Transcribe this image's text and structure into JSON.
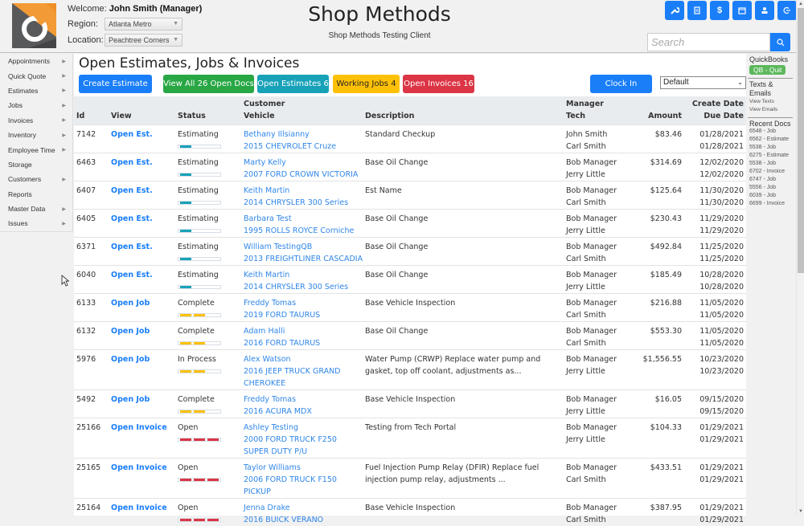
{
  "header": {
    "welcome_label": "Welcome:",
    "user_name": "John Smith (Manager)",
    "region_label": "Region:",
    "region_value": "Atlanta Metro",
    "location_label": "Location:",
    "location_value": "Peachtree Corners",
    "app_title": "Shop Methods",
    "app_subtitle": "Shop Methods Testing Client",
    "search_placeholder": "Search",
    "tool_buttons": [
      "wrench-icon",
      "clipboard-icon",
      "dollar-icon",
      "calendar-icon",
      "user-icon",
      "logout-icon"
    ]
  },
  "sidebar": {
    "items": [
      {
        "label": "Appointments",
        "has_submenu": true
      },
      {
        "label": "Quick Quote",
        "has_submenu": true
      },
      {
        "label": "Estimates",
        "has_submenu": true
      },
      {
        "label": "Jobs",
        "has_submenu": true
      },
      {
        "label": "Invoices",
        "has_submenu": true
      },
      {
        "label": "Inventory",
        "has_submenu": true
      },
      {
        "label": "Employee Time",
        "has_submenu": true
      },
      {
        "label": "Storage",
        "has_submenu": false
      },
      {
        "label": "Customers",
        "has_submenu": true
      },
      {
        "label": "Reports",
        "has_submenu": false
      },
      {
        "label": "Master Data",
        "has_submenu": true
      },
      {
        "label": "Issues",
        "has_submenu": true
      }
    ]
  },
  "main": {
    "title": "Open Estimates, Jobs & Invoices",
    "buttons": {
      "create_estimate": "Create Estimate",
      "view_all": "View All 26 Open Docs",
      "open_estimates": "Open Estimates 6",
      "working_jobs": "Working Jobs 4",
      "open_invoices": "Open Invoices 16",
      "clock_in": "Clock In"
    },
    "view_select": "Default",
    "columns": {
      "id": "Id",
      "view": "View",
      "status": "Status",
      "customer": "Customer",
      "vehicle": "Vehicle",
      "description": "Description",
      "manager": "Manager",
      "tech": "Tech",
      "amount": "Amount",
      "create_date": "Create Date",
      "due_date": "Due Date"
    },
    "rows": [
      {
        "id": "7142",
        "view": "Open Est.",
        "status": "Estimating",
        "progress": "estimate",
        "customer": "Bethany Illsianny",
        "vehicle": "2015 CHEVROLET Cruze",
        "description": "Standard Checkup",
        "manager": "John Smith",
        "tech": "Carl Smith",
        "amount": "$83.46",
        "create_date": "01/28/2021",
        "due_date": "01/28/2021"
      },
      {
        "id": "6463",
        "view": "Open Est.",
        "status": "Estimating",
        "progress": "estimate",
        "customer": "Marty Kelly",
        "vehicle": "2007 FORD CROWN VICTORIA",
        "description": "Base Oil Change",
        "manager": "Bob Manager",
        "tech": "Jerry Little",
        "amount": "$314.69",
        "create_date": "12/02/2020",
        "due_date": "12/02/2020"
      },
      {
        "id": "6407",
        "view": "Open Est.",
        "status": "Estimating",
        "progress": "estimate",
        "customer": "Keith Martin",
        "vehicle": "2014 CHRYSLER 300 Series",
        "description": "Est Name",
        "manager": "Bob Manager",
        "tech": "Carl Smith",
        "amount": "$125.64",
        "create_date": "11/30/2020",
        "due_date": "11/30/2020"
      },
      {
        "id": "6405",
        "view": "Open Est.",
        "status": "Estimating",
        "progress": "estimate",
        "customer": "Barbara Test",
        "vehicle": "1995 ROLLS ROYCE Corniche",
        "description": "Base Oil Change",
        "manager": "Bob Manager",
        "tech": "Jerry Little",
        "amount": "$230.43",
        "create_date": "11/29/2020",
        "due_date": "11/29/2020"
      },
      {
        "id": "6371",
        "view": "Open Est.",
        "status": "Estimating",
        "progress": "estimate",
        "customer": "William TestingQB",
        "vehicle": "2013 FREIGHTLINER CASCADIA",
        "description": "Base Oil Change",
        "manager": "Bob Manager",
        "tech": "Carl Smith",
        "amount": "$492.84",
        "create_date": "11/25/2020",
        "due_date": "11/25/2020"
      },
      {
        "id": "6040",
        "view": "Open Est.",
        "status": "Estimating",
        "progress": "estimate",
        "customer": "Keith Martin",
        "vehicle": "2014 CHRYSLER 300 Series",
        "description": "Base Oil Change",
        "manager": "Bob Manager",
        "tech": "Jerry Little",
        "amount": "$185.49",
        "create_date": "10/28/2020",
        "due_date": "10/28/2020"
      },
      {
        "id": "6133",
        "view": "Open Job",
        "status": "Complete",
        "progress": "job",
        "customer": "Freddy Tomas",
        "vehicle": "2019 FORD TAURUS",
        "description": "Base Vehicle Inspection",
        "manager": "Bob Manager",
        "tech": "Carl Smith",
        "amount": "$216.88",
        "create_date": "11/05/2020",
        "due_date": "11/05/2020"
      },
      {
        "id": "6132",
        "view": "Open Job",
        "status": "Complete",
        "progress": "job",
        "customer": "Adam Halli",
        "vehicle": "2016 FORD TAURUS",
        "description": "Base Oil Change",
        "manager": "Bob Manager",
        "tech": "Carl Smith",
        "amount": "$553.30",
        "create_date": "11/05/2020",
        "due_date": "11/05/2020"
      },
      {
        "id": "5976",
        "view": "Open Job",
        "status": "In Process",
        "progress": "job",
        "customer": "Alex Watson",
        "vehicle": "2016 JEEP TRUCK GRAND CHEROKEE",
        "description": "Water Pump (CRWP) Replace water pump and gasket, top off coolant, adjustments as...",
        "manager": "Bob Manager",
        "tech": "Jerry Little",
        "amount": "$1,556.55",
        "create_date": "10/23/2020",
        "due_date": "10/23/2020"
      },
      {
        "id": "5492",
        "view": "Open Job",
        "status": "Complete",
        "progress": "job",
        "customer": "Freddy Tomas",
        "vehicle": "2016 ACURA MDX",
        "description": "Base Vehicle Inspection",
        "manager": "Bob Manager",
        "tech": "Jerry Little",
        "amount": "$16.05",
        "create_date": "09/15/2020",
        "due_date": "09/15/2020"
      },
      {
        "id": "25166",
        "view": "Open Invoice",
        "status": "Open",
        "progress": "invoice",
        "customer": "Ashley Testing",
        "vehicle": "2000 FORD TRUCK F250 SUPER DUTY P/U",
        "description": "Testing from Tech Portal",
        "manager": "Bob Manager",
        "tech": "Jerry Little",
        "amount": "$104.33",
        "create_date": "01/29/2021",
        "due_date": "01/29/2021"
      },
      {
        "id": "25165",
        "view": "Open Invoice",
        "status": "Open",
        "progress": "invoice",
        "customer": "Taylor Williams",
        "vehicle": "2006 FORD TRUCK F150 PICKUP",
        "description": "Fuel Injection Pump Relay (DFIR) Replace fuel injection pump relay, adjustments ...",
        "manager": "Bob Manager",
        "tech": "Carl Smith",
        "amount": "$433.51",
        "create_date": "01/29/2021",
        "due_date": "01/29/2021"
      },
      {
        "id": "25164",
        "view": "Open Invoice",
        "status": "Open",
        "progress": "invoice",
        "customer": "Jenna Drake",
        "vehicle": "2016 BUICK VERANO",
        "description": "Base Vehicle Inspection",
        "manager": "Bob Manager",
        "tech": "Carl Smith",
        "amount": "$387.95",
        "create_date": "01/29/2021",
        "due_date": "01/29/2021"
      }
    ]
  },
  "right_panel": {
    "quickbooks_label": "QuickBooks",
    "qb_button": "QB - Quit",
    "texts_emails_label": "Texts & Emails",
    "view_texts": "View Texts",
    "view_emails": "View Emails",
    "recent_docs_label": "Recent Docs",
    "recent_docs": [
      "6548 - Job",
      "6562 - Estimate",
      "5538 - Job",
      "6275 - Estimate",
      "5538 - Job",
      "6702 - Invoice",
      "6747 - Job",
      "5556 - Job",
      "6039 - Job",
      "6699 - Invoice"
    ]
  },
  "colors": {
    "primary": "#1a7ef9",
    "success": "#28a745",
    "info": "#17a2b8",
    "warning": "#ffc107",
    "danger": "#dc3545"
  }
}
